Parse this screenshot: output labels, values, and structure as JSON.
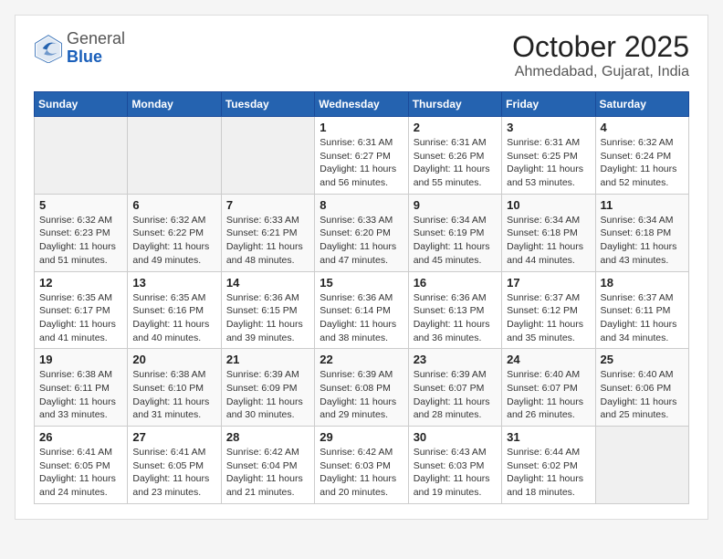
{
  "logo": {
    "general": "General",
    "blue": "Blue"
  },
  "header": {
    "month": "October 2025",
    "location": "Ahmedabad, Gujarat, India"
  },
  "weekdays": [
    "Sunday",
    "Monday",
    "Tuesday",
    "Wednesday",
    "Thursday",
    "Friday",
    "Saturday"
  ],
  "weeks": [
    [
      {
        "day": "",
        "info": ""
      },
      {
        "day": "",
        "info": ""
      },
      {
        "day": "",
        "info": ""
      },
      {
        "day": "1",
        "info": "Sunrise: 6:31 AM\nSunset: 6:27 PM\nDaylight: 11 hours\nand 56 minutes."
      },
      {
        "day": "2",
        "info": "Sunrise: 6:31 AM\nSunset: 6:26 PM\nDaylight: 11 hours\nand 55 minutes."
      },
      {
        "day": "3",
        "info": "Sunrise: 6:31 AM\nSunset: 6:25 PM\nDaylight: 11 hours\nand 53 minutes."
      },
      {
        "day": "4",
        "info": "Sunrise: 6:32 AM\nSunset: 6:24 PM\nDaylight: 11 hours\nand 52 minutes."
      }
    ],
    [
      {
        "day": "5",
        "info": "Sunrise: 6:32 AM\nSunset: 6:23 PM\nDaylight: 11 hours\nand 51 minutes."
      },
      {
        "day": "6",
        "info": "Sunrise: 6:32 AM\nSunset: 6:22 PM\nDaylight: 11 hours\nand 49 minutes."
      },
      {
        "day": "7",
        "info": "Sunrise: 6:33 AM\nSunset: 6:21 PM\nDaylight: 11 hours\nand 48 minutes."
      },
      {
        "day": "8",
        "info": "Sunrise: 6:33 AM\nSunset: 6:20 PM\nDaylight: 11 hours\nand 47 minutes."
      },
      {
        "day": "9",
        "info": "Sunrise: 6:34 AM\nSunset: 6:19 PM\nDaylight: 11 hours\nand 45 minutes."
      },
      {
        "day": "10",
        "info": "Sunrise: 6:34 AM\nSunset: 6:18 PM\nDaylight: 11 hours\nand 44 minutes."
      },
      {
        "day": "11",
        "info": "Sunrise: 6:34 AM\nSunset: 6:18 PM\nDaylight: 11 hours\nand 43 minutes."
      }
    ],
    [
      {
        "day": "12",
        "info": "Sunrise: 6:35 AM\nSunset: 6:17 PM\nDaylight: 11 hours\nand 41 minutes."
      },
      {
        "day": "13",
        "info": "Sunrise: 6:35 AM\nSunset: 6:16 PM\nDaylight: 11 hours\nand 40 minutes."
      },
      {
        "day": "14",
        "info": "Sunrise: 6:36 AM\nSunset: 6:15 PM\nDaylight: 11 hours\nand 39 minutes."
      },
      {
        "day": "15",
        "info": "Sunrise: 6:36 AM\nSunset: 6:14 PM\nDaylight: 11 hours\nand 38 minutes."
      },
      {
        "day": "16",
        "info": "Sunrise: 6:36 AM\nSunset: 6:13 PM\nDaylight: 11 hours\nand 36 minutes."
      },
      {
        "day": "17",
        "info": "Sunrise: 6:37 AM\nSunset: 6:12 PM\nDaylight: 11 hours\nand 35 minutes."
      },
      {
        "day": "18",
        "info": "Sunrise: 6:37 AM\nSunset: 6:11 PM\nDaylight: 11 hours\nand 34 minutes."
      }
    ],
    [
      {
        "day": "19",
        "info": "Sunrise: 6:38 AM\nSunset: 6:11 PM\nDaylight: 11 hours\nand 33 minutes."
      },
      {
        "day": "20",
        "info": "Sunrise: 6:38 AM\nSunset: 6:10 PM\nDaylight: 11 hours\nand 31 minutes."
      },
      {
        "day": "21",
        "info": "Sunrise: 6:39 AM\nSunset: 6:09 PM\nDaylight: 11 hours\nand 30 minutes."
      },
      {
        "day": "22",
        "info": "Sunrise: 6:39 AM\nSunset: 6:08 PM\nDaylight: 11 hours\nand 29 minutes."
      },
      {
        "day": "23",
        "info": "Sunrise: 6:39 AM\nSunset: 6:07 PM\nDaylight: 11 hours\nand 28 minutes."
      },
      {
        "day": "24",
        "info": "Sunrise: 6:40 AM\nSunset: 6:07 PM\nDaylight: 11 hours\nand 26 minutes."
      },
      {
        "day": "25",
        "info": "Sunrise: 6:40 AM\nSunset: 6:06 PM\nDaylight: 11 hours\nand 25 minutes."
      }
    ],
    [
      {
        "day": "26",
        "info": "Sunrise: 6:41 AM\nSunset: 6:05 PM\nDaylight: 11 hours\nand 24 minutes."
      },
      {
        "day": "27",
        "info": "Sunrise: 6:41 AM\nSunset: 6:05 PM\nDaylight: 11 hours\nand 23 minutes."
      },
      {
        "day": "28",
        "info": "Sunrise: 6:42 AM\nSunset: 6:04 PM\nDaylight: 11 hours\nand 21 minutes."
      },
      {
        "day": "29",
        "info": "Sunrise: 6:42 AM\nSunset: 6:03 PM\nDaylight: 11 hours\nand 20 minutes."
      },
      {
        "day": "30",
        "info": "Sunrise: 6:43 AM\nSunset: 6:03 PM\nDaylight: 11 hours\nand 19 minutes."
      },
      {
        "day": "31",
        "info": "Sunrise: 6:44 AM\nSunset: 6:02 PM\nDaylight: 11 hours\nand 18 minutes."
      },
      {
        "day": "",
        "info": ""
      }
    ]
  ]
}
